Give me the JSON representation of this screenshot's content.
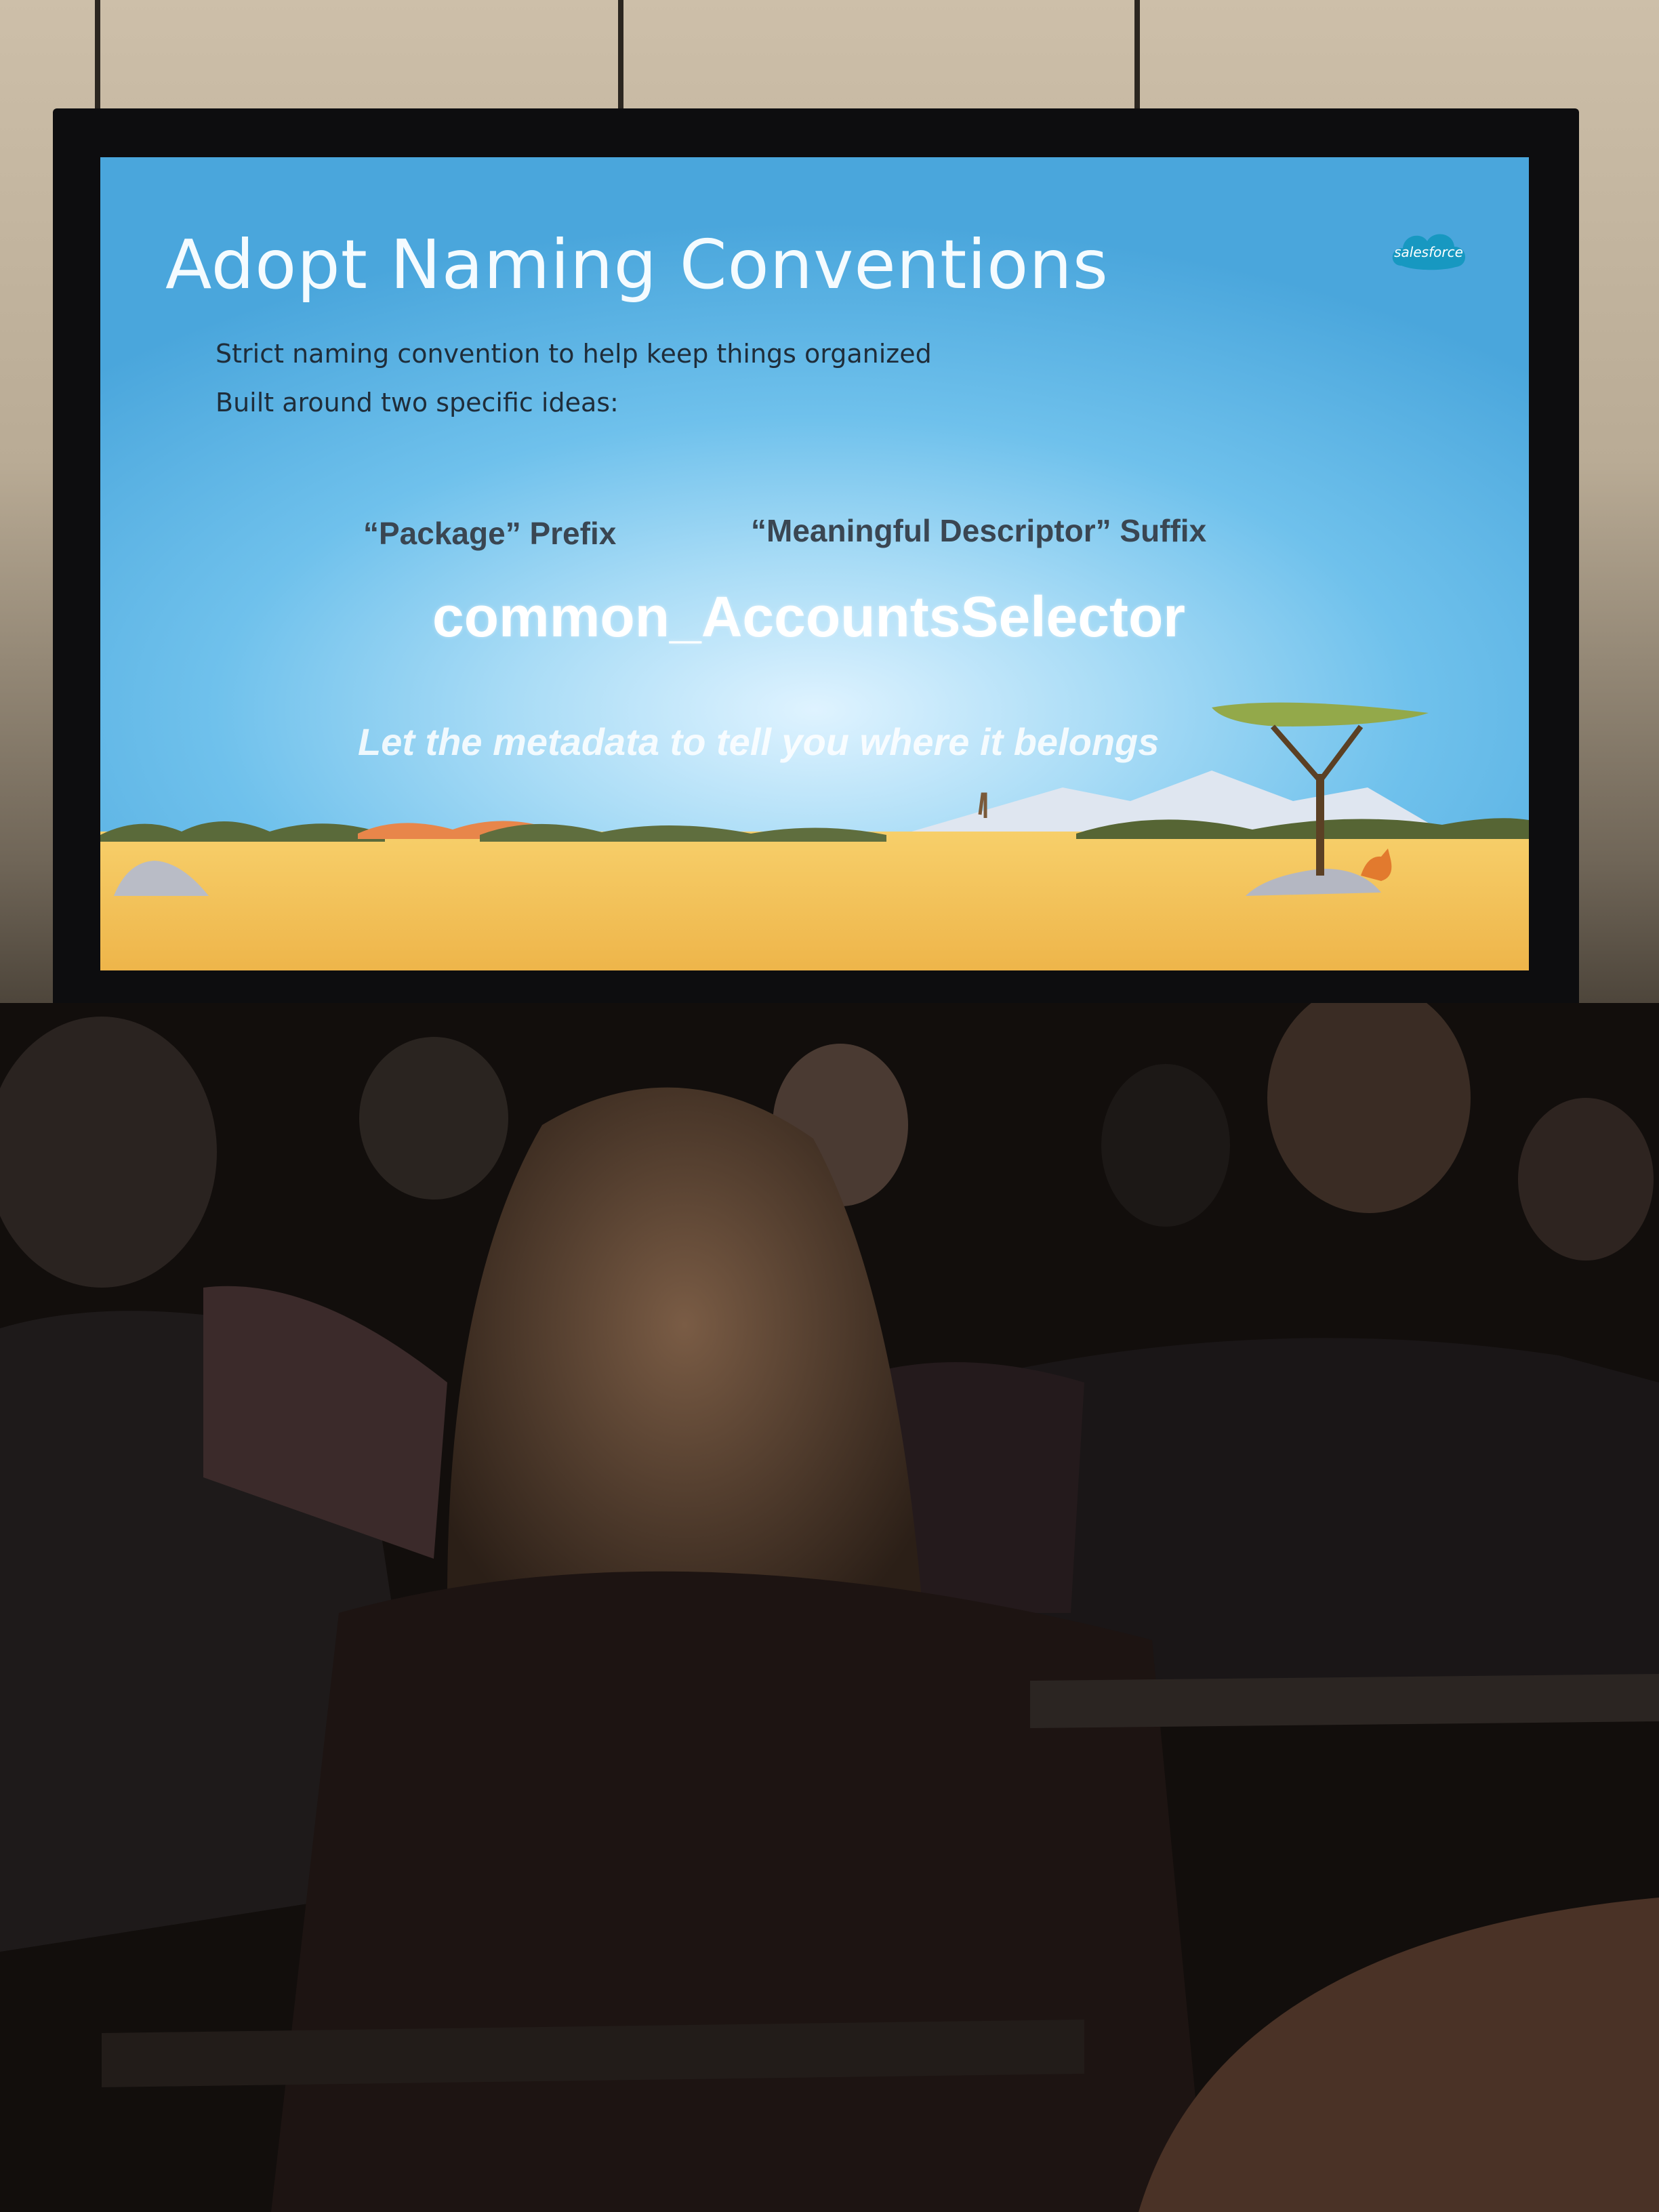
{
  "slide": {
    "title": "Adopt Naming Conventions",
    "logo_text": "salesforce",
    "bullets": [
      "Strict naming convention to help keep things organized",
      "Built around two specific ideas:"
    ],
    "ideas": {
      "prefix": "“Package” Prefix",
      "suffix": "“Meaningful Descriptor” Suffix"
    },
    "example": "common_AccountsSelector",
    "tagline": "Let the metadata to tell you where it belongs"
  },
  "colors": {
    "sky_top": "#4aa6dc",
    "sky_center": "#dff3ff",
    "ground": "#f2c35a",
    "logo": "#1798c1"
  }
}
